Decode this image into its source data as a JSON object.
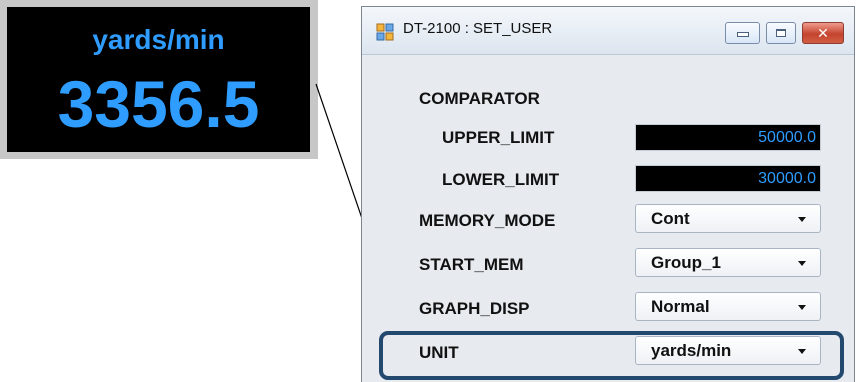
{
  "display": {
    "unit": "yards/min",
    "value": "3356.5",
    "color": "#2f9dff"
  },
  "window": {
    "title": "DT-2100 : SET_USER",
    "controls": {
      "minimize_icon": "minimize-icon",
      "maximize_icon": "maximize-icon",
      "close_icon": "close-icon",
      "close_label": "✕"
    }
  },
  "settings": {
    "comparator_label": "COMPARATOR",
    "upper_limit_label": "UPPER_LIMIT",
    "upper_limit_value": "50000.0",
    "lower_limit_label": "LOWER_LIMIT",
    "lower_limit_value": "30000.0",
    "memory_mode_label": "MEMORY_MODE",
    "memory_mode_value": "Cont",
    "start_mem_label": "START_MEM",
    "start_mem_value": "Group_1",
    "graph_disp_label": "GRAPH_DISP",
    "graph_disp_value": "Normal",
    "unit_label": "UNIT",
    "unit_value": "yards/min"
  },
  "highlight": {
    "color": "#24496f"
  }
}
